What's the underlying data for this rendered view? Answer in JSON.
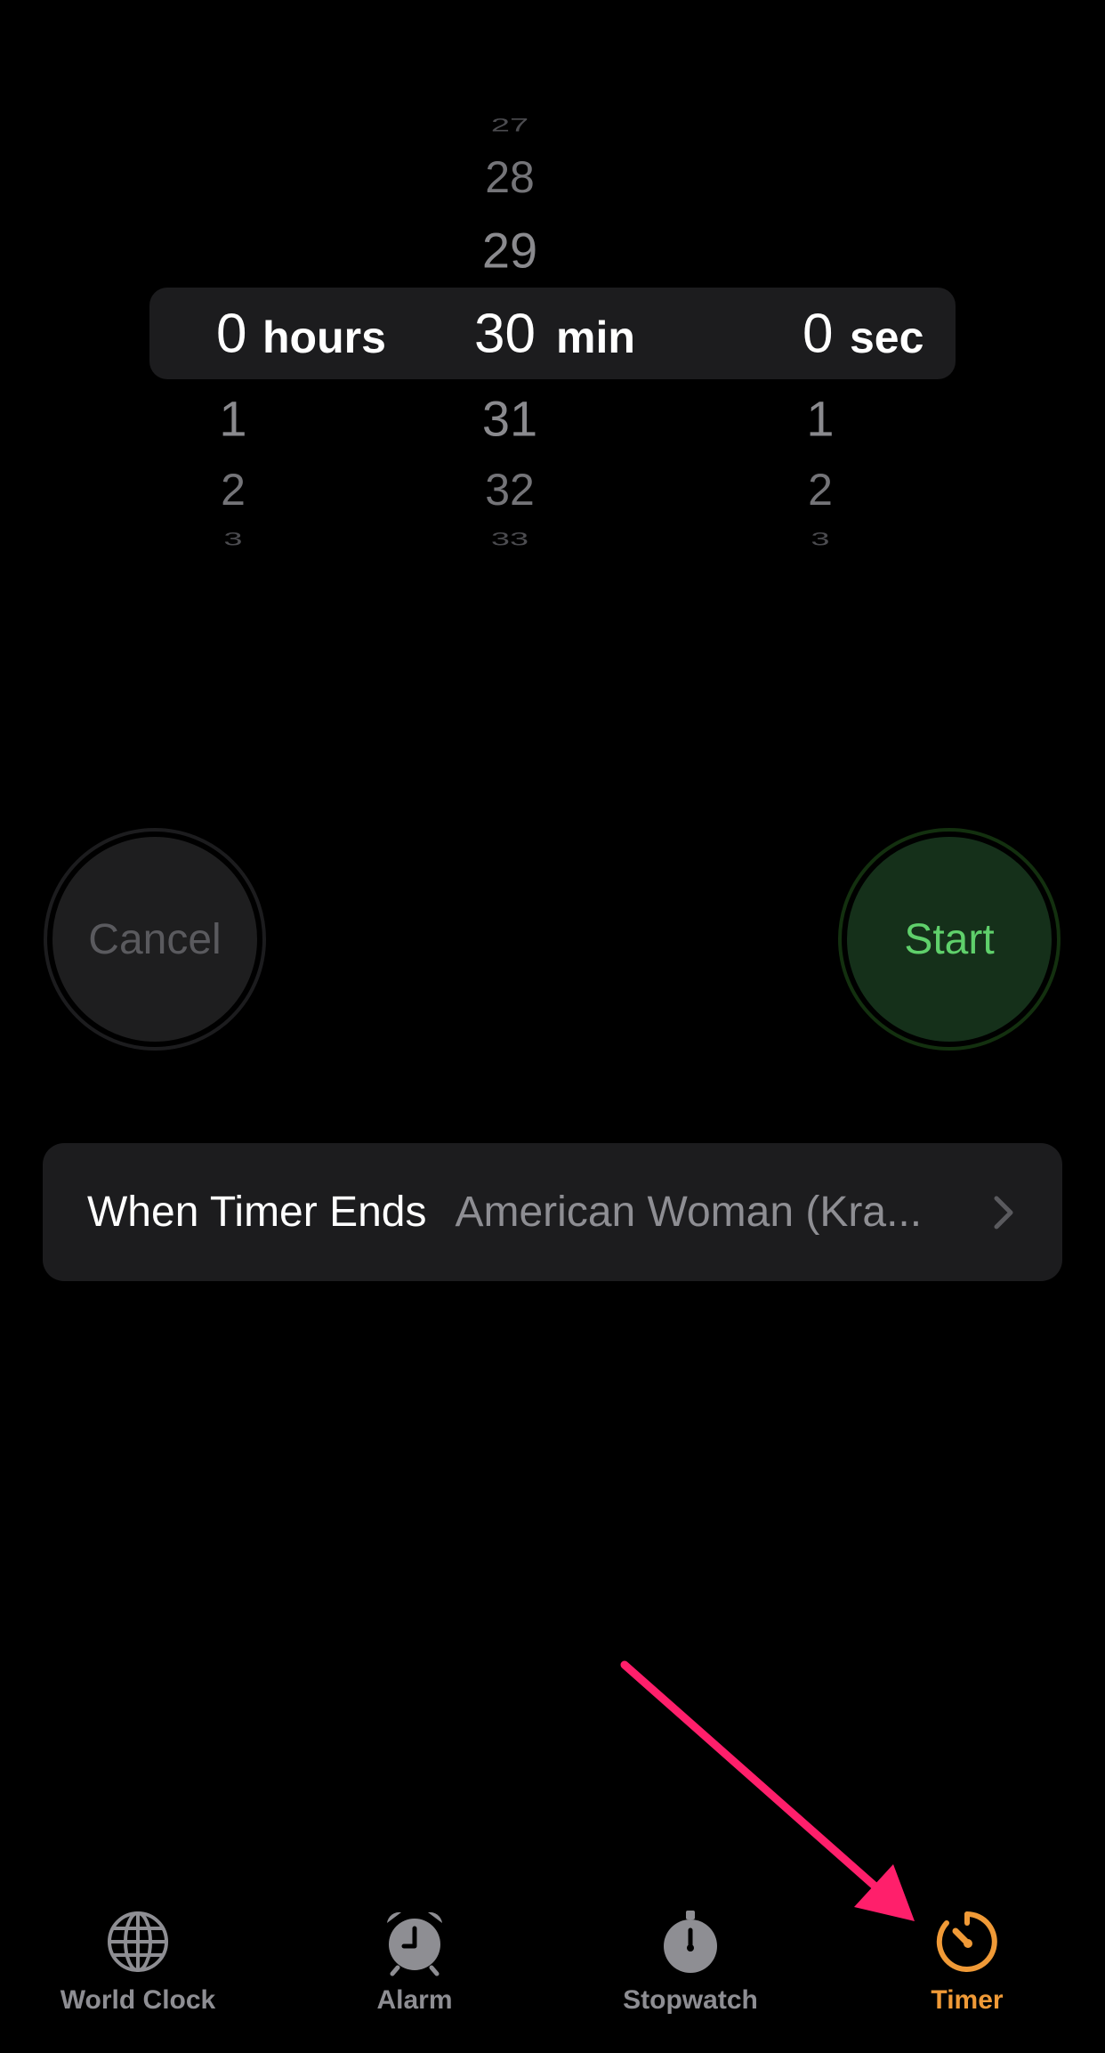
{
  "picker": {
    "hours": {
      "above": [],
      "selected": "0",
      "unit": "hours",
      "below": [
        "1",
        "2",
        "3"
      ]
    },
    "minutes": {
      "above": [
        "27",
        "28",
        "29"
      ],
      "selected": "30",
      "unit": "min",
      "below": [
        "31",
        "32",
        "33"
      ]
    },
    "seconds": {
      "above": [],
      "selected": "0",
      "unit": "sec",
      "below": [
        "1",
        "2",
        "3"
      ]
    }
  },
  "buttons": {
    "cancel_label": "Cancel",
    "start_label": "Start"
  },
  "when_timer_ends": {
    "label": "When Timer Ends",
    "value": "American Woman (Kra..."
  },
  "tabbar": {
    "items": [
      {
        "label": "World Clock",
        "icon": "globe-icon"
      },
      {
        "label": "Alarm",
        "icon": "alarm-clock-icon"
      },
      {
        "label": "Stopwatch",
        "icon": "stopwatch-icon"
      },
      {
        "label": "Timer",
        "icon": "timer-icon"
      }
    ],
    "active": "Timer"
  },
  "colors": {
    "accent": "#f09a37",
    "start_green": "#5fd06b",
    "arrow": "#ff1f6b"
  }
}
